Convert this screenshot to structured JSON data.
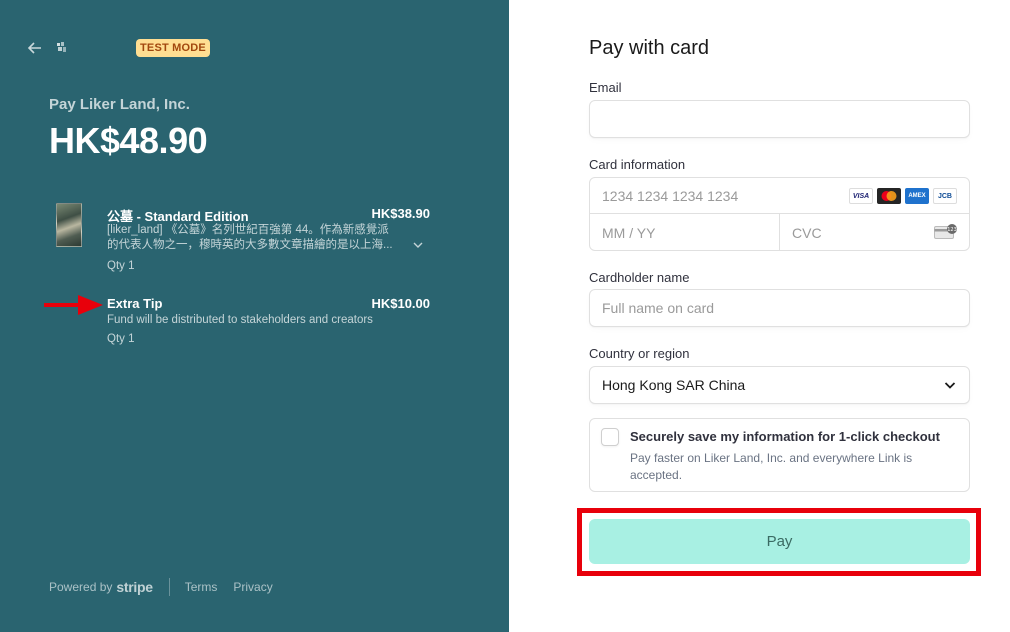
{
  "header": {
    "test_mode": "TEST MODE"
  },
  "summary": {
    "pay_to": "Pay Liker Land, Inc.",
    "total": "HK$48.90",
    "items": [
      {
        "name": "公墓 - Standard Edition",
        "price": "HK$38.90",
        "description_line1": "[liker_land] 《公墓》名列世紀百強第 44。作為新感覺派",
        "description_line2": "的代表人物之一，穆時英的大多數文章描繪的是以上海...",
        "qty": "Qty 1"
      },
      {
        "name": "Extra Tip",
        "price": "HK$10.00",
        "description": "Fund will be distributed to stakeholders and creators",
        "qty": "Qty 1"
      }
    ]
  },
  "footer": {
    "powered_by": "Powered by",
    "stripe": "stripe",
    "terms": "Terms",
    "privacy": "Privacy"
  },
  "form": {
    "title": "Pay with card",
    "email_label": "Email",
    "email_value": "",
    "card_label": "Card information",
    "card_number_placeholder": "1234 1234 1234 1234",
    "expiry_placeholder": "MM / YY",
    "cvc_placeholder": "CVC",
    "brands": [
      "VISA",
      "Mastercard",
      "AMEX",
      "JCB"
    ],
    "cardholder_label": "Cardholder name",
    "cardholder_placeholder": "Full name on card",
    "country_label": "Country or region",
    "country_value": "Hong Kong SAR China",
    "save_title": "Securely save my information for 1-click checkout",
    "save_desc": "Pay faster on Liker Land, Inc. and everywhere Link is accepted.",
    "save_checked": false,
    "pay_label": "Pay"
  },
  "colors": {
    "left_panel": "#2a6470",
    "pay_button": "#a8f0e3",
    "annotation": "#e8000b",
    "test_badge_bg": "#ffde92"
  }
}
